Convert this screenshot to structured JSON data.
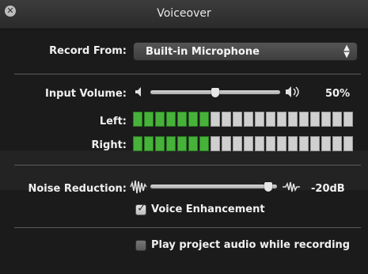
{
  "window": {
    "title": "Voiceover"
  },
  "record_from": {
    "label": "Record From:",
    "value": "Built-in Microphone"
  },
  "input_volume": {
    "label": "Input Volume:",
    "value_text": "50%",
    "level": 0.5
  },
  "meters": {
    "left": {
      "label": "Left:",
      "lit": 7,
      "total": 20
    },
    "right": {
      "label": "Right:",
      "lit": 7,
      "total": 20
    }
  },
  "noise_reduction": {
    "label": "Noise Reduction:",
    "value_text": "-20dB",
    "level": 0.93
  },
  "voice_enhancement": {
    "label": "Voice Enhancement",
    "checked": true
  },
  "play_project_audio": {
    "label": "Play project audio while recording",
    "checked": false
  },
  "colors": {
    "meter_on": "#47b23a",
    "meter_off": "#cfcfcf"
  }
}
